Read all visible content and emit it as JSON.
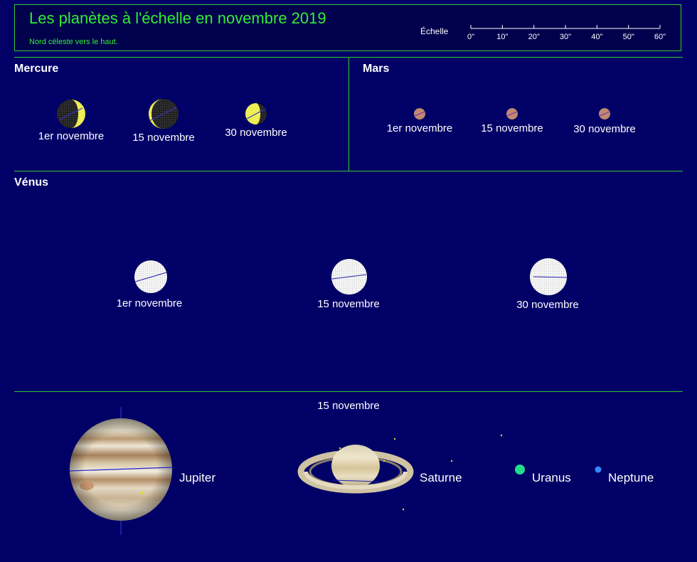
{
  "header": {
    "title": "Les planètes à l'échelle en novembre 2019",
    "subtitle": "Nord céleste vers le haut.",
    "scale": {
      "label": "Échelle",
      "ticks": [
        "0\"",
        "10\"",
        "20\"",
        "30\"",
        "40\"",
        "50\"",
        "60\""
      ]
    }
  },
  "mercury": {
    "name": "Mercure",
    "dates": [
      "1er novembre",
      "15 novembre",
      "30 novembre"
    ]
  },
  "mars": {
    "name": "Mars",
    "dates": [
      "1er novembre",
      "15 novembre",
      "30 novembre"
    ]
  },
  "venus": {
    "name": "Vénus",
    "dates": [
      "1er novembre",
      "15 novembre",
      "30 novembre"
    ]
  },
  "outer": {
    "date": "15 novembre",
    "jupiter": "Jupiter",
    "saturn": "Saturne",
    "uranus": "Uranus",
    "neptune": "Neptune"
  },
  "colors": {
    "background": "#000066",
    "frame": "#33cc33",
    "title": "#33ee33",
    "mercury": "#eeee55",
    "mars": "#c08870",
    "venus": "#f0f0f0",
    "uranus": "#22dd88",
    "neptune": "#3388ff"
  }
}
